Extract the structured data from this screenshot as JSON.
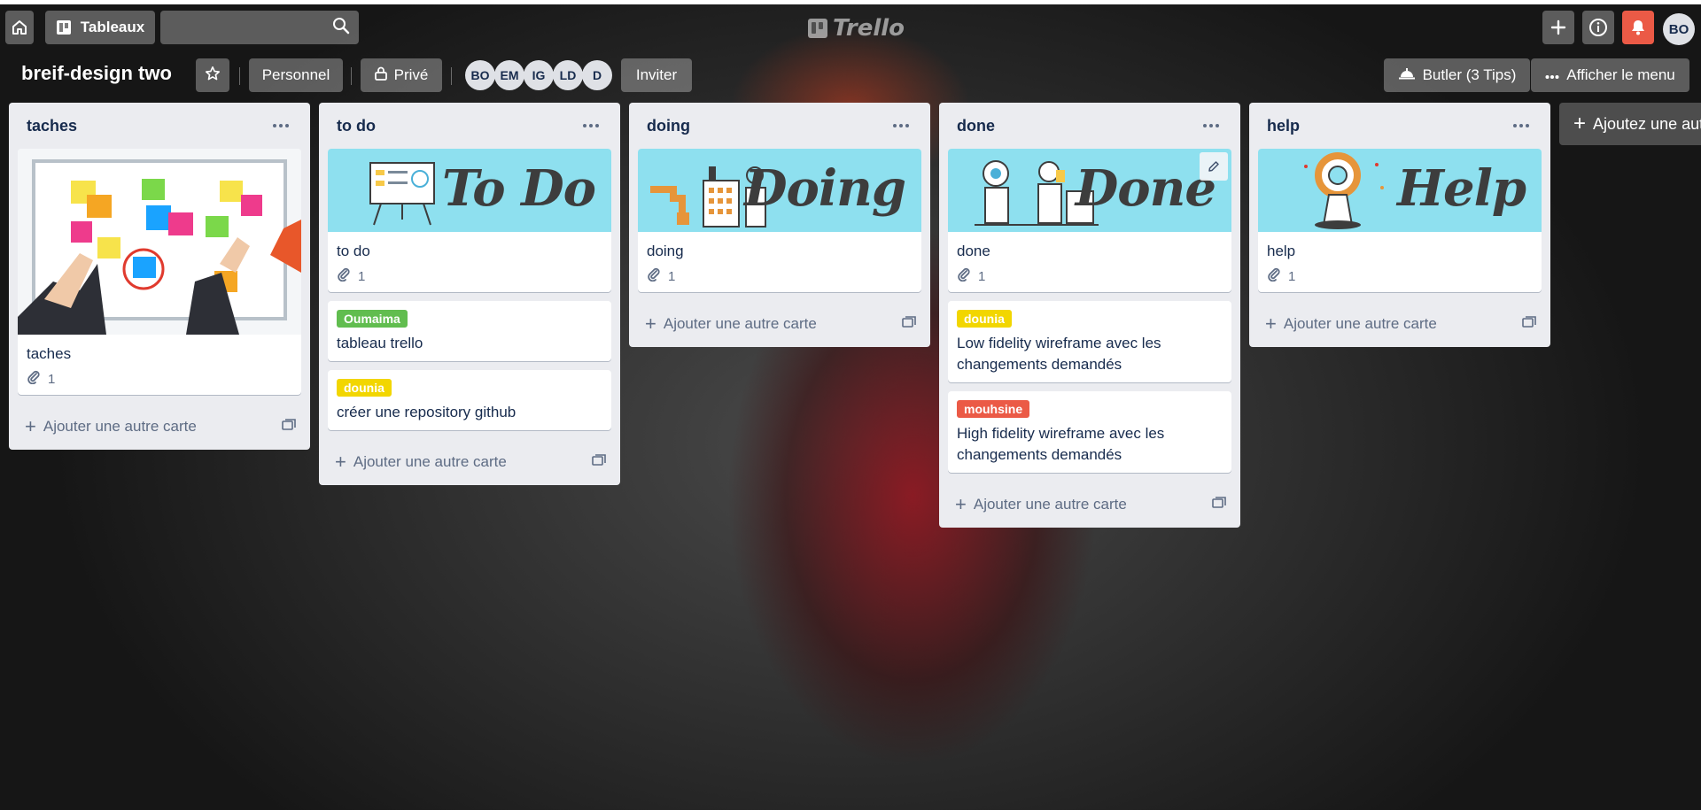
{
  "header": {
    "home_icon": "home-icon",
    "boards_label": "Tableaux",
    "search_placeholder": "",
    "logo_text": "Trello",
    "user_initials": "BO"
  },
  "board": {
    "title": "breif-design two",
    "team_label": "Personnel",
    "visibility_label": "Privé",
    "members": [
      "BO",
      "EM",
      "IG",
      "LD",
      "D"
    ],
    "invite_label": "Inviter",
    "butler_label": "Butler (3 Tips)",
    "menu_label": "Afficher le menu"
  },
  "add_card_label": "Ajouter une autre carte",
  "add_list_label": "Ajoutez une autre liste",
  "lists": [
    {
      "title": "taches",
      "cards": [
        {
          "title": "taches",
          "attachments": "1"
        }
      ]
    },
    {
      "title": "to do",
      "cover_text": "To Do",
      "cards": [
        {
          "title": "to do",
          "attachments": "1"
        },
        {
          "label": "Oumaima",
          "title": "tableau trello"
        },
        {
          "label": "dounia",
          "title": "créer une repository github"
        }
      ]
    },
    {
      "title": "doing",
      "cover_text": "Doing",
      "cards": [
        {
          "title": "doing",
          "attachments": "1"
        }
      ]
    },
    {
      "title": "done",
      "cover_text": "Done",
      "cards": [
        {
          "title": "done",
          "attachments": "1"
        },
        {
          "label": "dounia",
          "title": "Low fidelity wireframe avec les changements demandés"
        },
        {
          "label": "mouhsine",
          "title": "High fidelity wireframe avec les changements demandés"
        }
      ]
    },
    {
      "title": "help",
      "cover_text": "Help",
      "cards": [
        {
          "title": "help",
          "attachments": "1"
        }
      ]
    }
  ],
  "colors": {
    "label_green": "#61bd4f",
    "label_yellow": "#f2d600",
    "label_red": "#eb5a46",
    "notification_red": "#eb5a46",
    "cover_cyan": "#8ee0ef"
  }
}
